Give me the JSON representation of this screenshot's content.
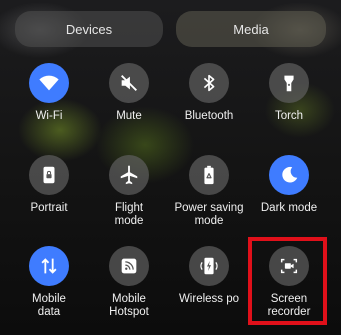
{
  "header": {
    "devices_label": "Devices",
    "media_label": "Media"
  },
  "colors": {
    "accent": "#3f7cff",
    "highlight": "#e0101a"
  },
  "tiles": [
    {
      "label": "Wi-Fi",
      "icon": "wifi-icon",
      "active": true
    },
    {
      "label": "Mute",
      "icon": "mute-icon",
      "active": false
    },
    {
      "label": "Bluetooth",
      "icon": "bluetooth-icon",
      "active": false
    },
    {
      "label": "Torch",
      "icon": "torch-icon",
      "active": false
    },
    {
      "label": "Portrait",
      "icon": "portrait-icon",
      "active": false
    },
    {
      "label": "Flight\nmode",
      "icon": "airplane-icon",
      "active": false
    },
    {
      "label": "Power saving\nmode",
      "icon": "battery-recycle-icon",
      "active": false
    },
    {
      "label": "Dark mode",
      "icon": "moon-icon",
      "active": true
    },
    {
      "label": "Mobile\ndata",
      "icon": "data-arrows-icon",
      "active": true
    },
    {
      "label": "Mobile\nHotspot",
      "icon": "hotspot-icon",
      "active": false
    },
    {
      "label": "Wireless po",
      "icon": "wireless-power-icon",
      "active": false
    },
    {
      "label": "Screen\nrecorder",
      "icon": "screen-recorder-icon",
      "active": false
    }
  ]
}
